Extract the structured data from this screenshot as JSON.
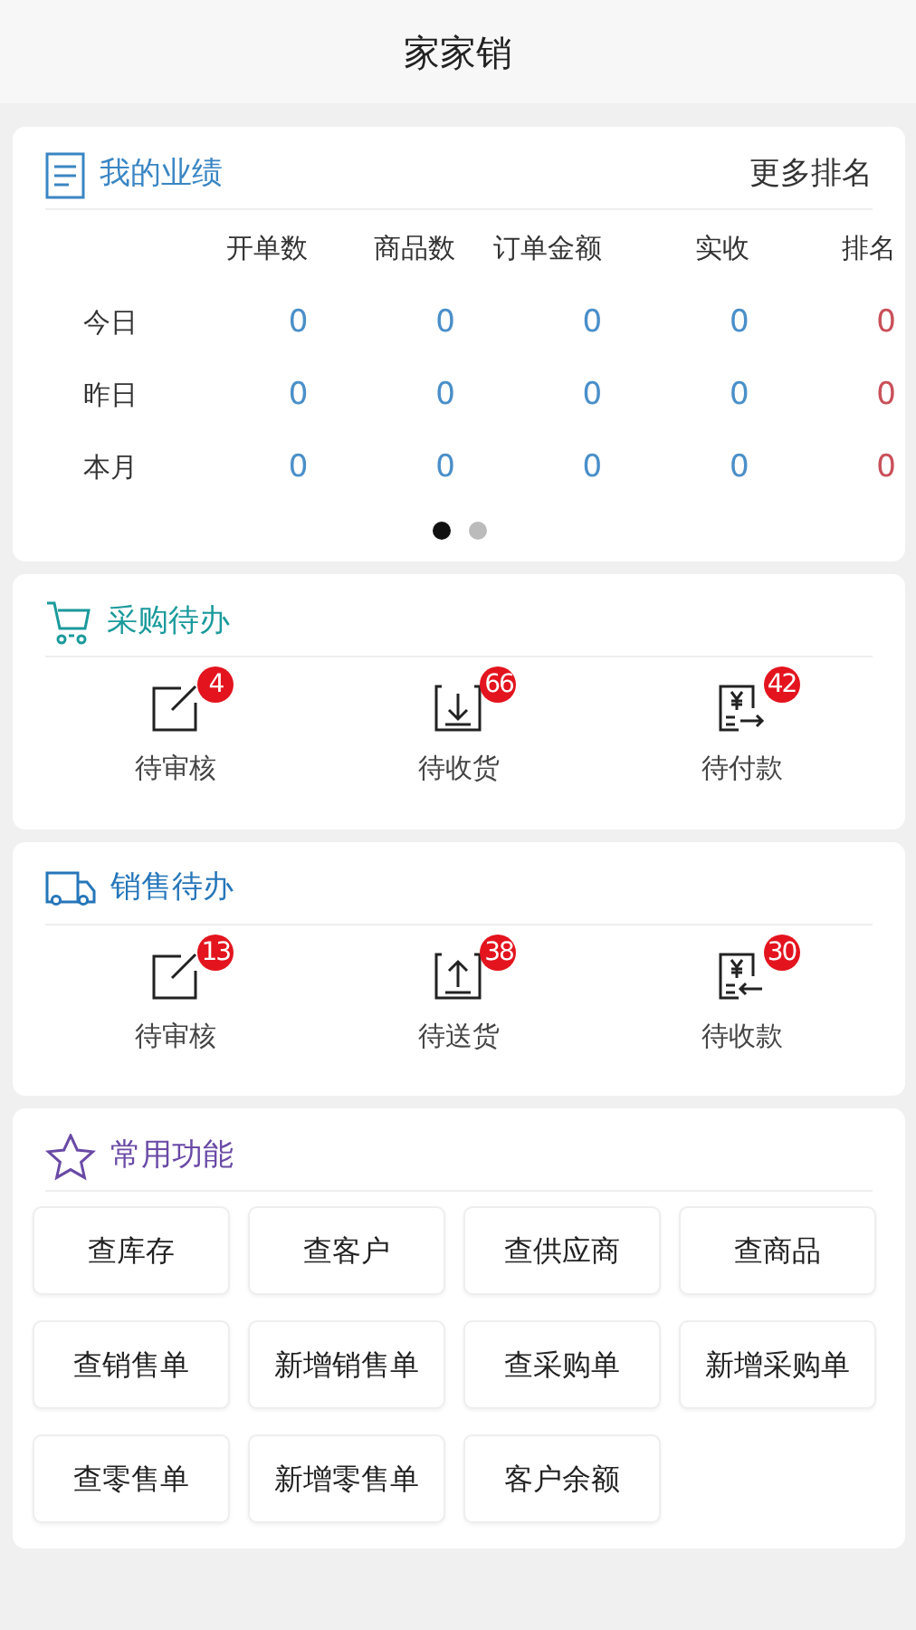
{
  "header": {
    "title": "家家销"
  },
  "performance": {
    "title": "我的业绩",
    "color": "#3a86c4",
    "link": "更多排名",
    "columns": [
      {
        "label": "开单数",
        "color": "#4a8fc9"
      },
      {
        "label": "商品数",
        "color": "#4a8fc9"
      },
      {
        "label": "订单金额",
        "color": "#4a8fc9"
      },
      {
        "label": "实收",
        "color": "#4a8fc9"
      },
      {
        "label": "排名",
        "color": "#c9505a"
      }
    ],
    "rows": [
      {
        "label": "今日",
        "values": [
          "0",
          "0",
          "0",
          "0",
          "0"
        ]
      },
      {
        "label": "昨日",
        "values": [
          "0",
          "0",
          "0",
          "0",
          "0"
        ]
      },
      {
        "label": "本月",
        "values": [
          "0",
          "0",
          "0",
          "0",
          "0"
        ]
      }
    ],
    "pager": [
      {
        "selected": true
      },
      {
        "selected": false
      }
    ]
  },
  "todo_sections": [
    {
      "title": "采购待办",
      "color": "#1b9a9c",
      "items": [
        {
          "kind": "review",
          "label": "待审核",
          "count": "4"
        },
        {
          "kind": "receive",
          "label": "待收货",
          "count": "66"
        },
        {
          "kind": "pay",
          "label": "待付款",
          "count": "42"
        }
      ]
    },
    {
      "title": "销售待办",
      "color": "#2576b9",
      "items": [
        {
          "kind": "review",
          "label": "待审核",
          "count": "13"
        },
        {
          "kind": "ship",
          "label": "待送货",
          "count": "38"
        },
        {
          "kind": "collect",
          "label": "待收款",
          "count": "30"
        }
      ]
    }
  ],
  "functions": {
    "title": "常用功能",
    "color": "#6a4aa6",
    "buttons": [
      "查库存",
      "查客户",
      "查供应商",
      "查商品",
      "查销售单",
      "新增销售单",
      "查采购单",
      "新增采购单",
      "查零售单",
      "新增零售单",
      "客户余额"
    ]
  }
}
